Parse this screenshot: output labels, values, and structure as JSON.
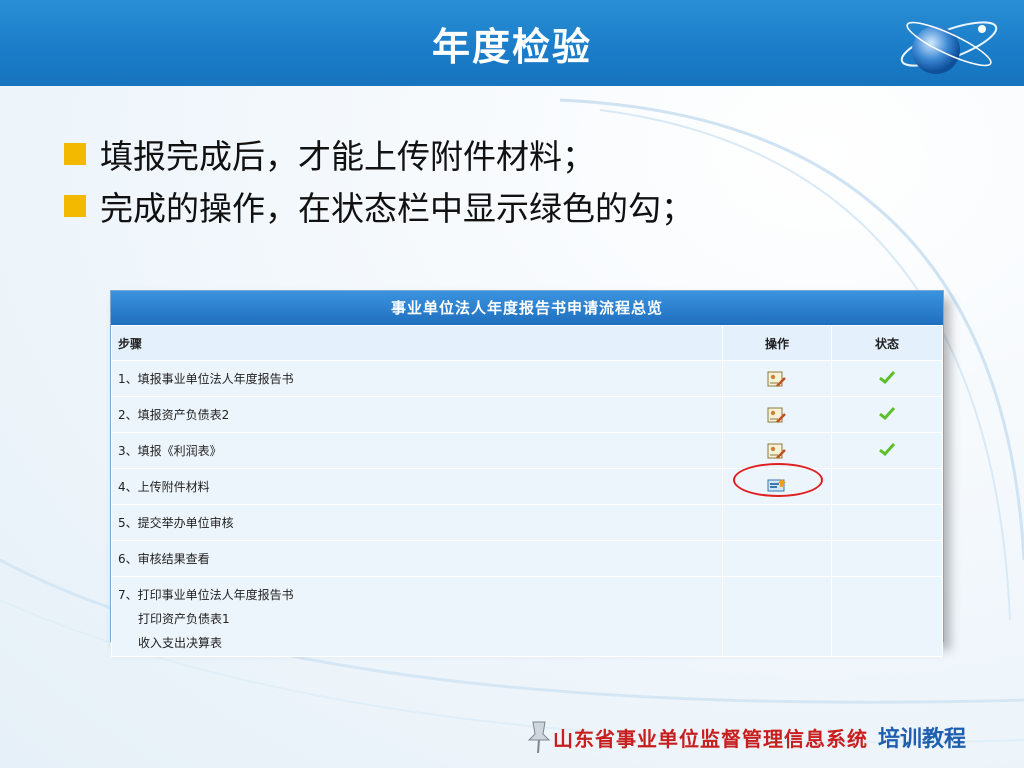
{
  "header": {
    "title": "年度检验"
  },
  "bullets": [
    "填报完成后，才能上传附件材料；",
    "完成的操作，在状态栏中显示绿色的勾；"
  ],
  "panel": {
    "title": "事业单位法人年度报告书申请流程总览",
    "columns": {
      "step": "步骤",
      "action": "操作",
      "status": "状态"
    },
    "rows": [
      {
        "step": "1、填报事业单位法人年度报告书",
        "action_icon": "edit-form-icon",
        "status_icon": "check-icon"
      },
      {
        "step": "2、填报资产负债表2",
        "action_icon": "edit-form-icon",
        "status_icon": "check-icon"
      },
      {
        "step": "3、填报《利润表》",
        "action_icon": "edit-form-icon",
        "status_icon": "check-icon"
      },
      {
        "step": "4、上传附件材料",
        "action_icon": "upload-icon",
        "status_icon": ""
      },
      {
        "step": "5、提交举办单位审核",
        "action_icon": "",
        "status_icon": ""
      },
      {
        "step": "6、审核结果查看",
        "action_icon": "",
        "status_icon": ""
      }
    ],
    "print_row": {
      "line1": "7、打印事业单位法人年度报告书",
      "line2": "打印资产负债表1",
      "line3": "收入支出决算表"
    }
  },
  "footer": {
    "system": "山东省事业单位监督管理信息系统",
    "tag": "培训教程"
  },
  "colors": {
    "header": "#1a7cc8",
    "bullet": "#f3b800",
    "check": "#5cbf2a",
    "highlight": "#e02020"
  }
}
